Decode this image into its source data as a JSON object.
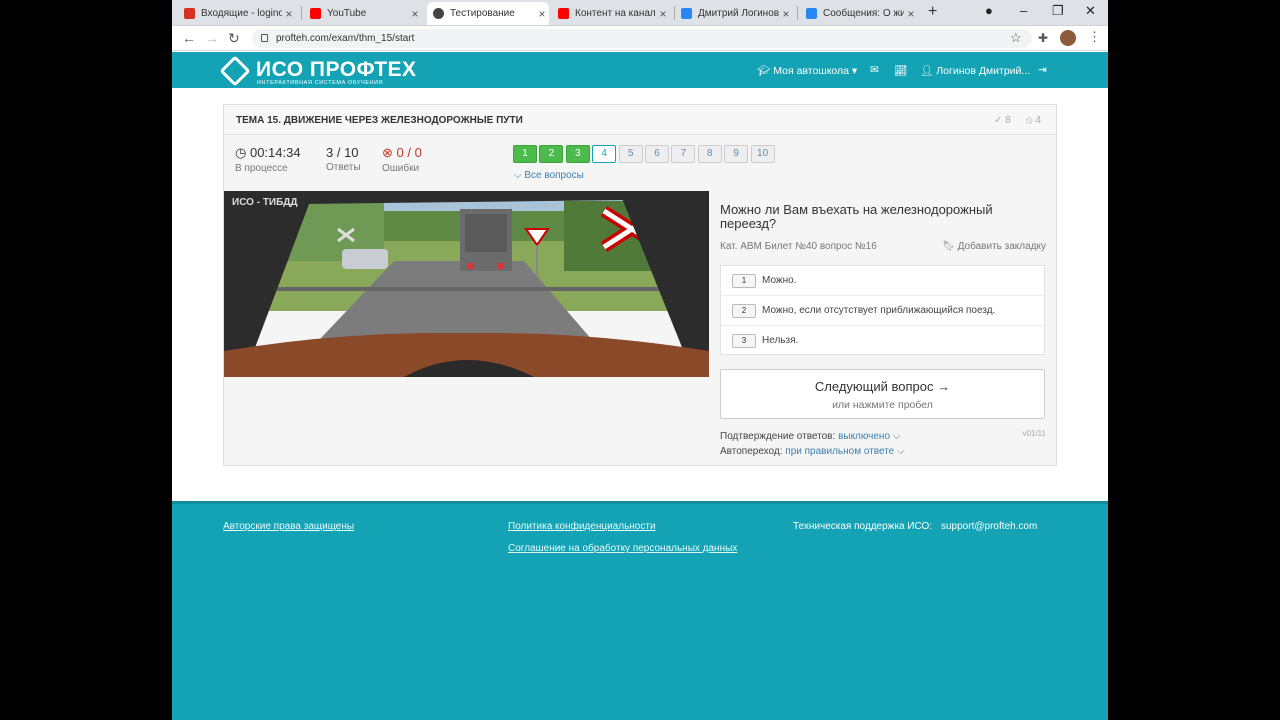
{
  "browser": {
    "tabs": [
      {
        "label": "Входящие - loginov",
        "icon_color": "#d93025"
      },
      {
        "label": "YouTube",
        "icon_color": "#ff0000"
      },
      {
        "label": "Тестирование",
        "icon_color": "#444444"
      },
      {
        "label": "Контент на канале",
        "icon_color": "#ff0000"
      },
      {
        "label": "Дмитрий Логинов",
        "icon_color": "#2787f5"
      },
      {
        "label": "Сообщения: О жиз",
        "icon_color": "#2787f5"
      }
    ],
    "url": "profteh.com/exam/thm_15/start"
  },
  "header": {
    "brand": "ИСО ПРОФТЕХ",
    "brand_sub": "ИНТЕРАКТИВНАЯ СИСТЕМА ОБУЧЕНИЯ",
    "school_menu": "Моя автошкола",
    "user": "Логинов Дмитрий..."
  },
  "exam": {
    "topic": "ТЕМА 15. ДВИЖЕНИЕ ЧЕРЕЗ ЖЕЛЕЗНОДОРОЖНЫЕ ПУТИ",
    "correct_count": "8",
    "wrong_count": "4",
    "timer": "00:14:34",
    "timer_label": "В процессе",
    "answers_value": "3 / 10",
    "answers_label": "Ответы",
    "errors_value": "0 / 0",
    "errors_label": "Ошибки",
    "questions": [
      "1",
      "2",
      "3",
      "4",
      "5",
      "6",
      "7",
      "8",
      "9",
      "10"
    ],
    "answered_count": 3,
    "current_index": 4,
    "all_questions": "Все вопросы",
    "watermark": "ИСО - ТИБДД"
  },
  "question": {
    "text": "Можно ли Вам въехать на железнодорожный переезд?",
    "meta": "Кат. ABM  Билет №40  вопрос №16",
    "bookmark": "Добавить закладку",
    "answers": [
      {
        "num": "1",
        "text": "Можно."
      },
      {
        "num": "2",
        "text": "Можно, если отсутствует приближающийся поезд."
      },
      {
        "num": "3",
        "text": "Нельзя."
      }
    ],
    "next_label": "Следующий вопрос →",
    "next_sub": "или нажмите пробел",
    "confirm_label": "Подтверждение ответов:",
    "confirm_value": "выключено",
    "auto_label": "Автопереход:",
    "auto_value": "при правильном ответе",
    "version": "v01/11"
  },
  "footer": {
    "copyright": "Авторские права защищены",
    "privacy": "Политика конфиденциальности",
    "agreement": "Соглашение на обработку персональных данных",
    "support_label": "Техническая поддержка ИСО:",
    "support_email": "support@profteh.com"
  },
  "colors": {
    "accent": "#13a3b4",
    "success": "#4cbb4c",
    "link": "#3c7fb0"
  }
}
